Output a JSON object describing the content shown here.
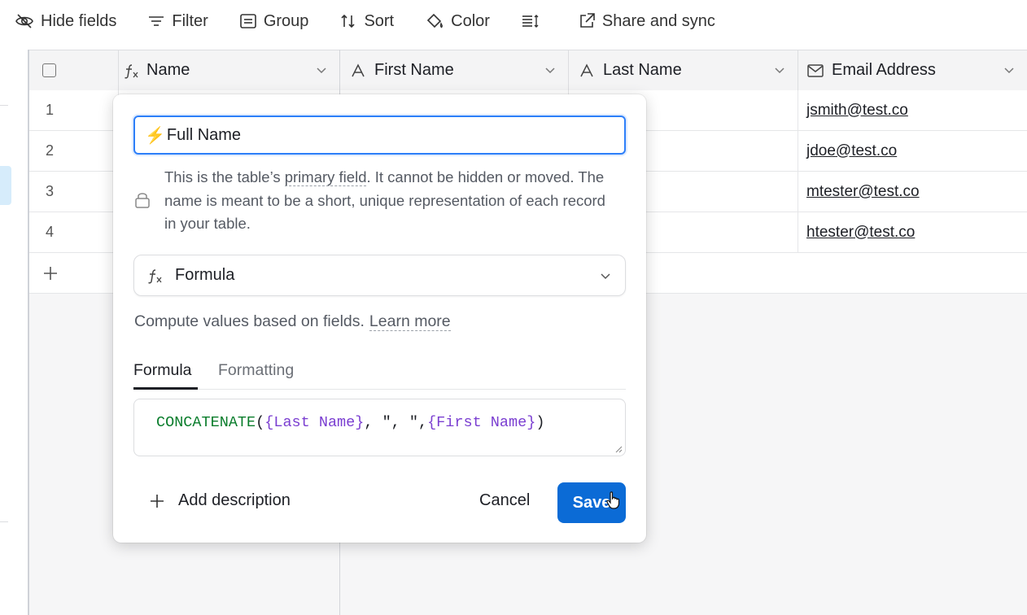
{
  "toolbar": {
    "items": [
      {
        "label": "Hide fields",
        "icon": "eye-off-icon"
      },
      {
        "label": "Filter",
        "icon": "filter-icon"
      },
      {
        "label": "Group",
        "icon": "group-icon"
      },
      {
        "label": "Sort",
        "icon": "sort-icon"
      },
      {
        "label": "Color",
        "icon": "paint-bucket-icon"
      },
      {
        "label": "",
        "icon": "row-height-icon"
      },
      {
        "label": "Share and sync",
        "icon": "share-icon"
      }
    ]
  },
  "grid": {
    "columns": [
      {
        "label": "Name",
        "icon": "formula-icon"
      },
      {
        "label": "First Name",
        "icon": "text-field-icon"
      },
      {
        "label": "Last Name",
        "icon": "text-field-icon"
      },
      {
        "label": "Email Address",
        "icon": "email-icon"
      }
    ],
    "rows": [
      {
        "num": "1",
        "email": "jsmith@test.co"
      },
      {
        "num": "2",
        "email": "jdoe@test.co"
      },
      {
        "num": "3",
        "email": "mtester@test.co"
      },
      {
        "num": "4",
        "email": "htester@test.co"
      }
    ],
    "add_row": "+"
  },
  "modal": {
    "name_value": "Full Name",
    "info_parts": {
      "a": "This is the table’s ",
      "b": "primary field",
      "c": ". It cannot be hidden or moved. The name is meant to be a short, unique representation of each record in your table."
    },
    "field_type": "Formula",
    "compute_text": "Compute values based on fields.",
    "learn_more": "Learn more",
    "tabs": [
      "Formula",
      "Formatting"
    ],
    "formula": {
      "fn": "CONCATENATE",
      "open": "(",
      "arg1": "{Last Name}",
      "sep": ", \", \",",
      "arg2": "{First Name}",
      "close": ")"
    },
    "add_description": "Add description",
    "cancel": "Cancel",
    "save": "Save"
  },
  "colors": {
    "accent": "#0b6bd6",
    "focus": "#2d7ff9",
    "formula_fn": "#0a7d2c",
    "formula_field": "#7b3fd1"
  }
}
